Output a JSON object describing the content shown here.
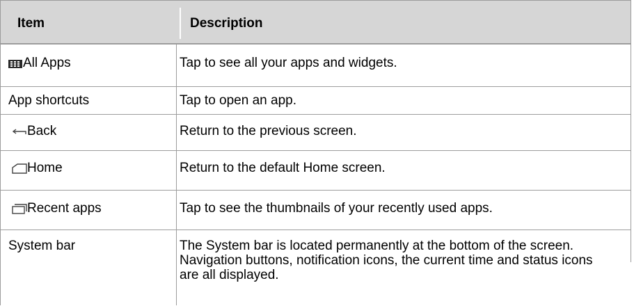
{
  "table": {
    "headers": {
      "item": "Item",
      "description": "Description"
    },
    "rows": [
      {
        "icon": "all-apps-grid-icon",
        "item": "All Apps",
        "description": "Tap to see all your apps and widgets."
      },
      {
        "icon": "",
        "item": "App shortcuts",
        "description": "Tap to open an app."
      },
      {
        "icon": "back-arrow-icon",
        "item": "Back",
        "description": "Return to the previous screen."
      },
      {
        "icon": "home-icon",
        "item": "Home",
        "description": "Return to the default Home screen."
      },
      {
        "icon": "recent-apps-icon",
        "item": "Recent apps",
        "description": "Tap to see the thumbnails of your recently used apps."
      },
      {
        "icon": "",
        "item": "System bar",
        "description": "The System bar is located permanently at the bottom of the screen. Navigation buttons, notification icons, the current time and status icons are all displayed."
      }
    ]
  },
  "colors": {
    "header_background": "#d6d6d6",
    "grid_line": "#9c9c9c"
  }
}
